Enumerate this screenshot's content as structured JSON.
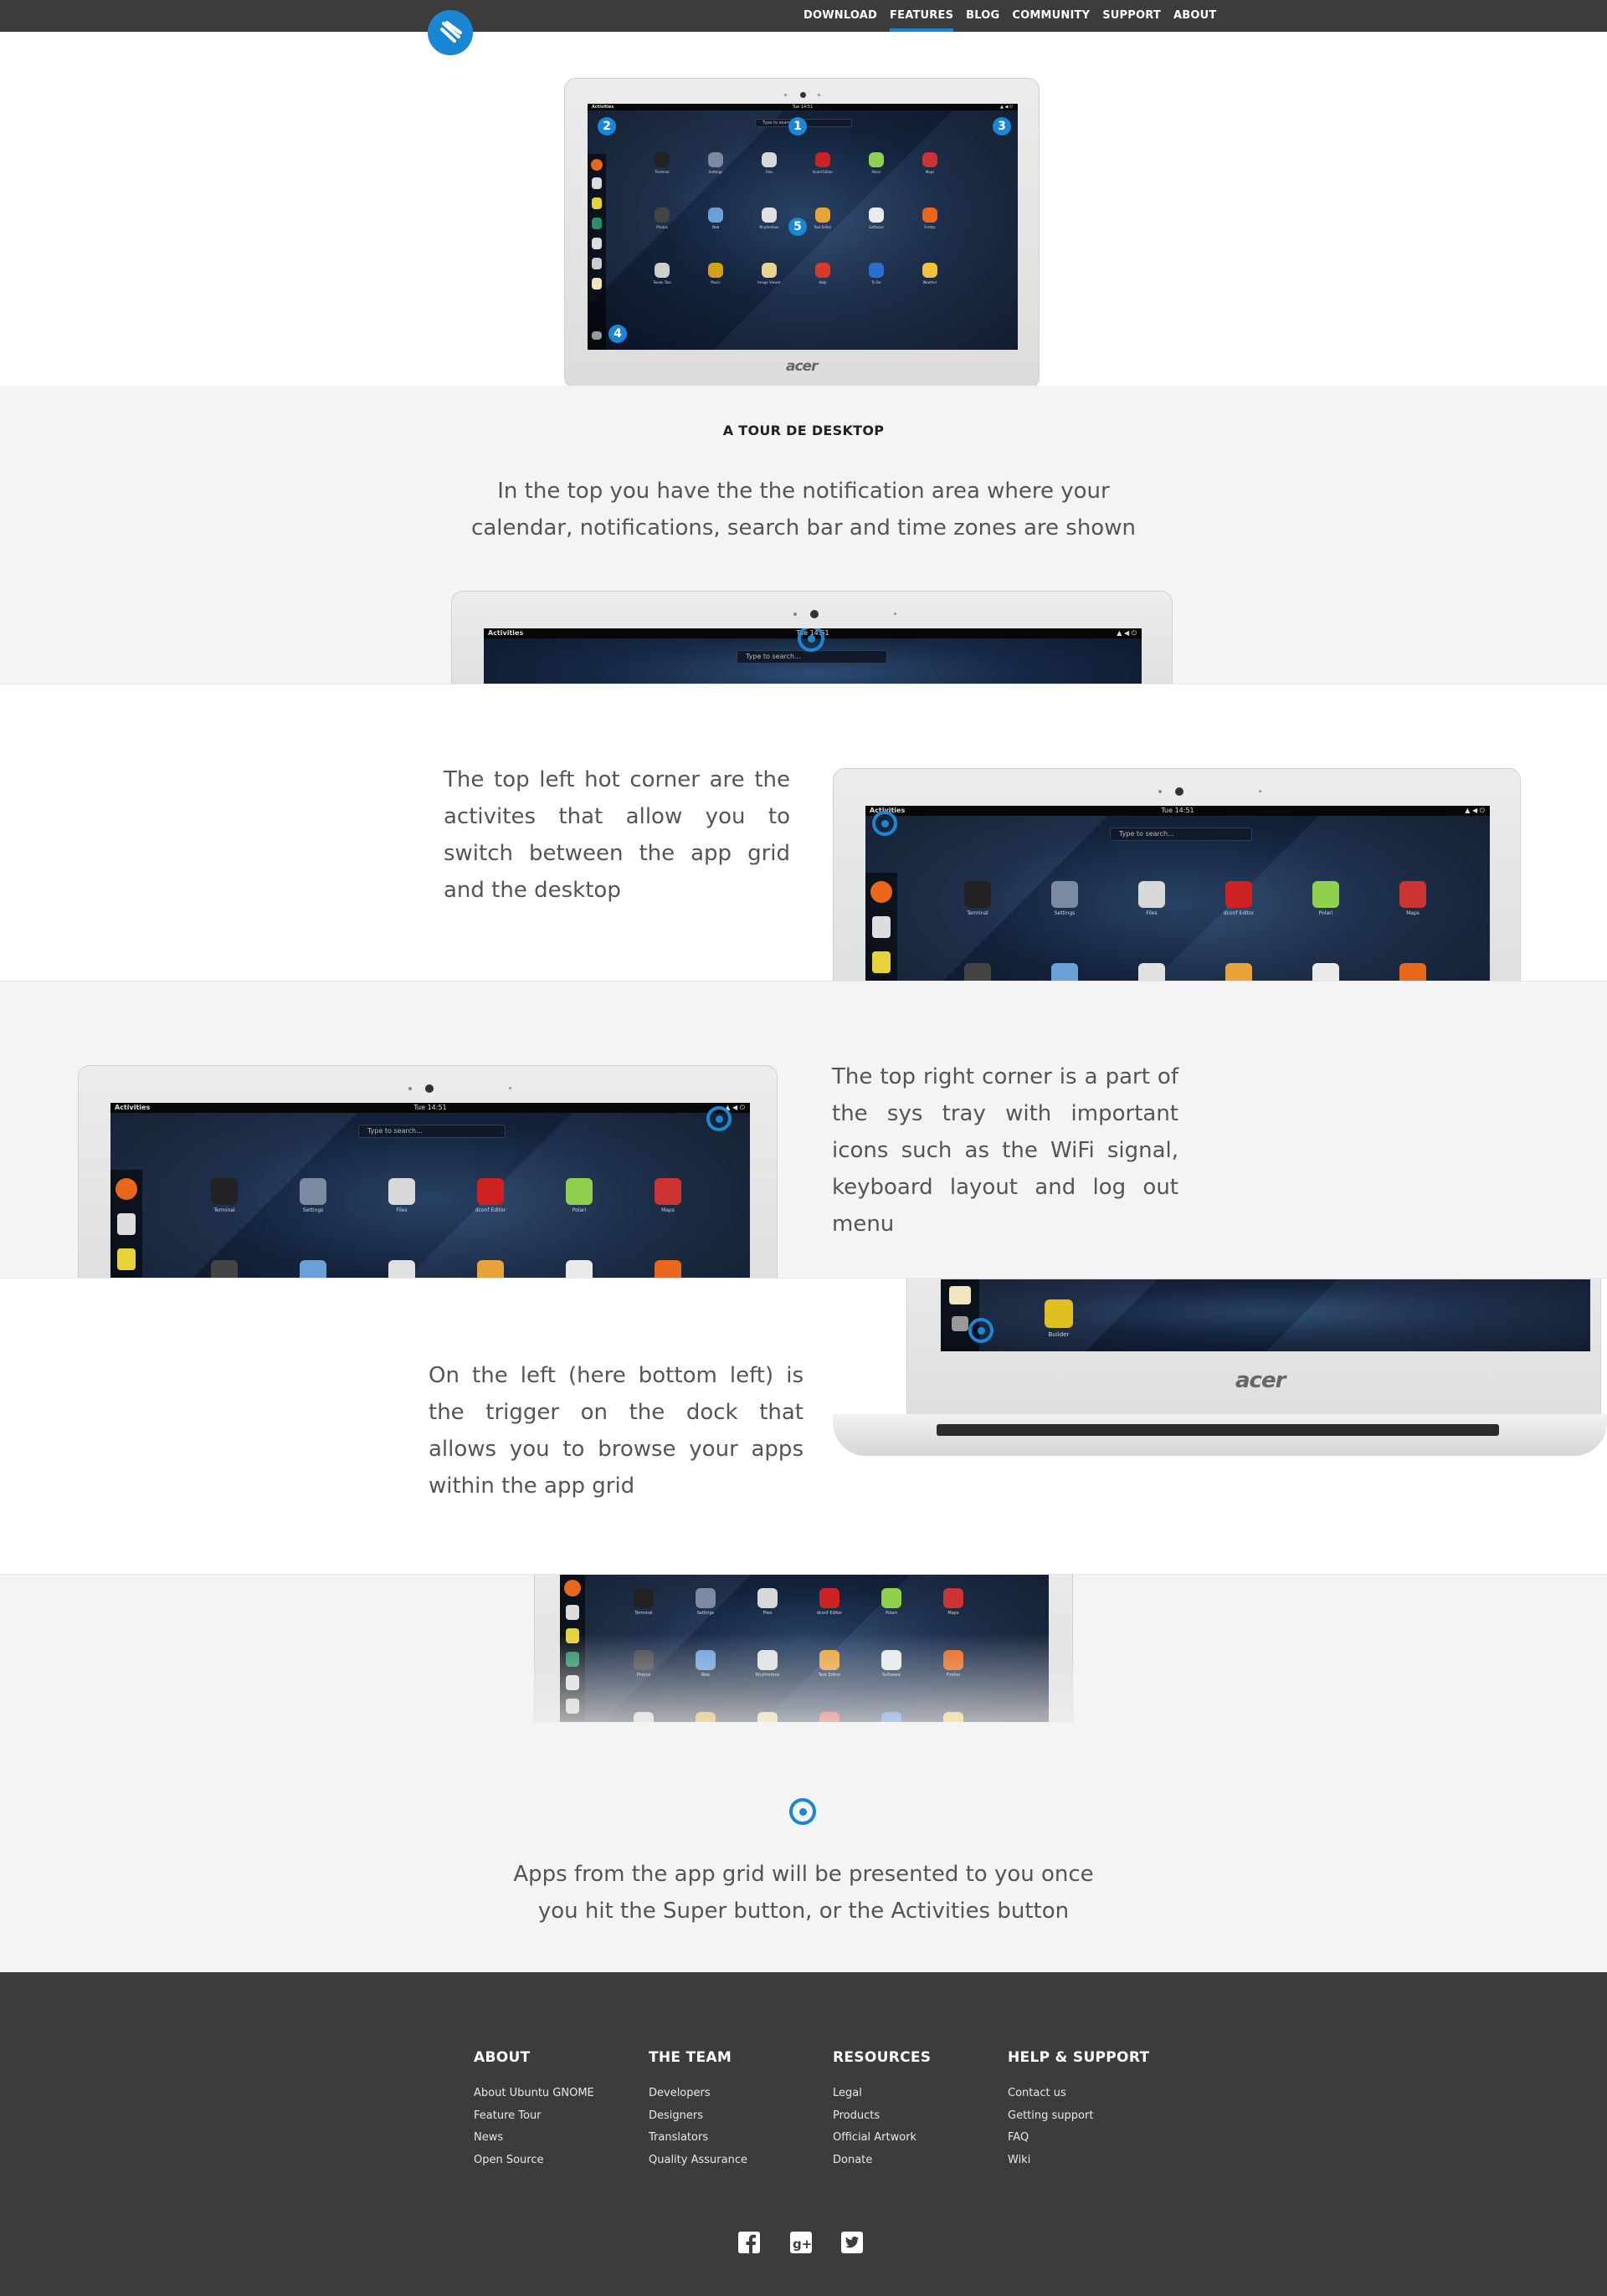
{
  "nav": {
    "logo_icon": "ubuntu-gnome-logo",
    "items": [
      {
        "label": "DOWNLOAD",
        "active": false
      },
      {
        "label": "FEATURES",
        "active": true
      },
      {
        "label": "BLOG",
        "active": false
      },
      {
        "label": "COMMUNITY",
        "active": false
      },
      {
        "label": "SUPPORT",
        "active": false
      },
      {
        "label": "ABOUT",
        "active": false
      }
    ]
  },
  "desktop": {
    "activities": "Activities",
    "clock": "Tue 14:51",
    "search_placeholder": "Type to search...",
    "brand": "acer",
    "apps": [
      "Terminal",
      "Settings",
      "Files",
      "dconf Editor",
      "Polari",
      "Maps",
      "Photos",
      "Web",
      "Rhythmbox",
      "Text Editor",
      "Software",
      "Firefox",
      "Tweak Tool",
      "Music",
      "Image Viewer",
      "Help",
      "To Do",
      "Weather"
    ],
    "builder": "Builder",
    "badges": [
      "1",
      "2",
      "3",
      "4",
      "5"
    ]
  },
  "tour": {
    "heading": "A TOUR DE DESKTOP",
    "intro": "In the top you have the the notification area where your calendar, notifications, search bar and time zones are shown",
    "top_left": "The top left hot corner are the activites that allow you to switch between the app grid and the desktop",
    "top_right": "The top right corner is a part of the sys tray with important icons such as the WiFi signal, keyboard layout and log out menu",
    "bottom_left": "On the left (here bottom left) is the trigger on the dock that allows you to browse your apps within the app grid",
    "app_grid": "Apps from the app grid will be presented to you once you hit the Super button, or the Activities button"
  },
  "footer": {
    "columns": [
      {
        "title": "ABOUT",
        "links": [
          "About Ubuntu GNOME",
          "Feature Tour",
          "News",
          "Open Source"
        ]
      },
      {
        "title": "THE TEAM",
        "links": [
          "Developers",
          "Designers",
          "Translators",
          "Quality Assurance"
        ]
      },
      {
        "title": "RESOURCES",
        "links": [
          "Legal",
          "Products",
          "Official Artwork",
          "Donate"
        ]
      },
      {
        "title": "HELP & SUPPORT",
        "links": [
          "Contact us",
          "Getting support",
          "FAQ",
          "Wiki"
        ]
      }
    ],
    "social": [
      "facebook-icon",
      "google-plus-icon",
      "twitter-icon"
    ]
  },
  "colors": {
    "accent": "#1a87d6",
    "nav_bg": "#3c3c3c",
    "section_grey": "#f4f4f4"
  }
}
